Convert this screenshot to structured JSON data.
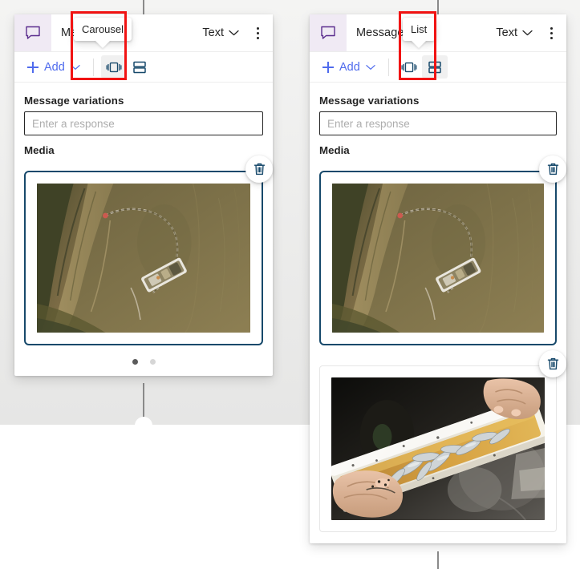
{
  "app": {
    "accent_blue": "#4f6bed",
    "accent_teal": "#17496b",
    "highlight_red": "#f11313",
    "header_icon_bg": "#f0eaf4",
    "chat_icon_color": "#5b2d8e"
  },
  "nodes": [
    {
      "id": "carousel-node",
      "icon": "chat-bubble-icon",
      "title": "Message",
      "type_label": "Text",
      "chevron": "chevron-down-icon",
      "overflow": "more-options-icon",
      "toolbar": {
        "add_label": "Add",
        "add_icon": "plus-icon",
        "add_chevron": "chevron-down-icon",
        "carousel_icon": "carousel-layout-icon",
        "list_icon": "list-layout-icon",
        "selected": "carousel"
      },
      "tooltip": "Carousel",
      "fields": {
        "variations_label": "Message variations",
        "variations_value": "",
        "variations_placeholder": "Enter a response",
        "media_label": "Media"
      },
      "media": [
        {
          "alt": "Aerial view of a fishing boat pulling a net in shallow brown water near a sandy shore",
          "delete_icon": "trash-icon",
          "selected": true
        }
      ],
      "pagination": {
        "dots": 2,
        "active_index": 0
      }
    },
    {
      "id": "list-node",
      "icon": "chat-bubble-icon",
      "title": "Message",
      "type_label": "Text",
      "chevron": "chevron-down-icon",
      "overflow": "more-options-icon",
      "toolbar": {
        "add_label": "Add",
        "add_icon": "plus-icon",
        "add_chevron": "chevron-down-icon",
        "carousel_icon": "carousel-layout-icon",
        "list_icon": "list-layout-icon",
        "selected": "list"
      },
      "tooltip": "List",
      "fields": {
        "variations_label": "Message variations",
        "variations_value": "",
        "variations_placeholder": "Enter a response",
        "media_label": "Media"
      },
      "media": [
        {
          "alt": "Aerial view of a fishing boat pulling a net in shallow brown water near a sandy shore",
          "delete_icon": "trash-icon",
          "selected": true
        },
        {
          "alt": "Hands holding a white trough filled with small silver fish",
          "delete_icon": "trash-icon",
          "selected": false
        }
      ],
      "pagination": null
    }
  ]
}
